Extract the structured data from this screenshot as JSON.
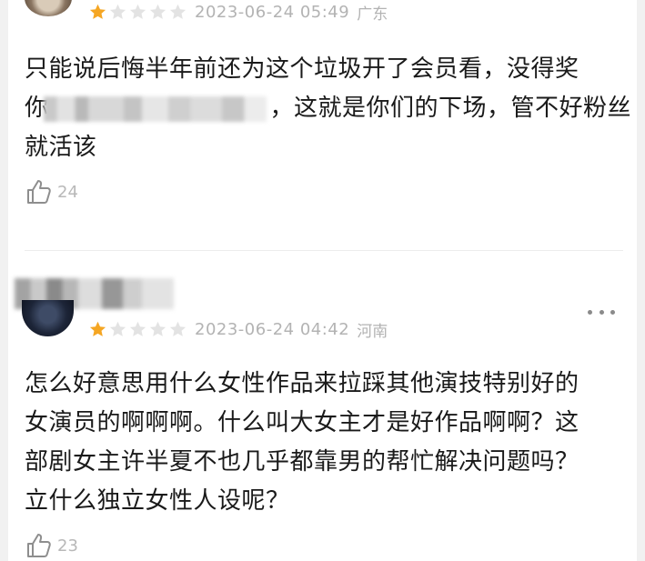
{
  "colors": {
    "star_filled": "#f5a623",
    "star_empty": "#e3e3e3",
    "meta_text": "#b3b3b3",
    "body_text": "#1a1a1a"
  },
  "comments": [
    {
      "rating": 1,
      "rating_max": 5,
      "timestamp": "2023-06-24 05:49",
      "location": "广东",
      "text_line1": "只能说后悔半年前还为这个垃圾开了会员看，没得奖",
      "text_line2_prefix": "你",
      "text_line2_suffix": "，这就是你们的下场，管不好粉丝",
      "text_line3": "就活该",
      "likes": "24",
      "like_icon": "thumbs-up-icon"
    },
    {
      "rating": 1,
      "rating_max": 5,
      "timestamp": "2023-06-24 04:42",
      "location": "河南",
      "text_line1": "怎么好意思用什么女性作品来拉踩其他演技特别好的",
      "text_line2": "女演员的啊啊啊。什么叫大女主才是好作品啊啊？这",
      "text_line3": "部剧女主许半夏不也几乎都靠男的帮忙解决问题吗？",
      "text_line4": "立什么独立女性人设呢？",
      "likes": "23",
      "like_icon": "thumbs-up-icon",
      "more_icon": "more-options-icon"
    }
  ]
}
